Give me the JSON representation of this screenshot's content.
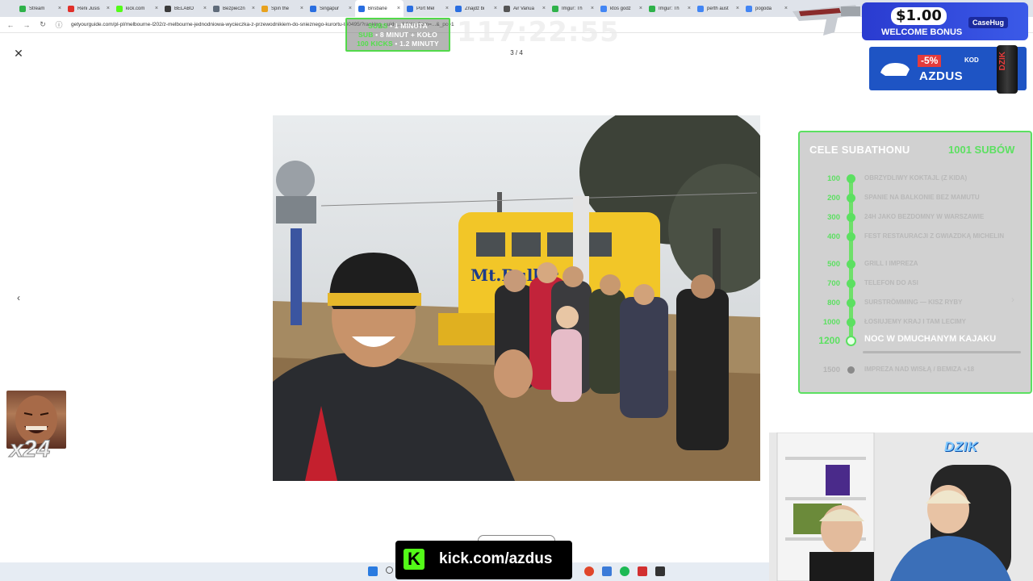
{
  "browser": {
    "tabs": [
      {
        "title": "Stream",
        "color": "#2fb24a"
      },
      {
        "title": "Reni Jusis",
        "color": "#e0302a"
      },
      {
        "title": "kick.com",
        "color": "#53fc18"
      },
      {
        "title": "BELABO",
        "color": "#3b3b3b"
      },
      {
        "title": "Bezpieczn",
        "color": "#5f6b7a"
      },
      {
        "title": "Spin the",
        "color": "#e8a21e"
      },
      {
        "title": "Singapur",
        "color": "#2a6ee0"
      },
      {
        "title": "Brisbane",
        "color": "#2a6ee0"
      },
      {
        "title": "Port Mel",
        "color": "#2a6ee0"
      },
      {
        "title": "Znajdź bi",
        "color": "#2a6ee0"
      },
      {
        "title": "Air Vanua",
        "color": "#555555"
      },
      {
        "title": "Imgur: Th",
        "color": "#2fb24a"
      },
      {
        "title": "ktoś godz",
        "color": "#4285f4"
      },
      {
        "title": "Imgur: Th",
        "color": "#2fb24a"
      },
      {
        "title": "perth aust",
        "color": "#4285f4"
      },
      {
        "title": "pogoda",
        "color": "#4285f4"
      }
    ],
    "url": "getyourguide.com/pl-pl/melbourne-l202/z-melbourne-jednodniowa-wycieczka-z-przewodnikiem-do-snieznego-kurortu-t40495/?ranking_uuid=...&date_from=...&_pc=1"
  },
  "lightbox": {
    "close_icon": "✕",
    "counter": "3 / 4",
    "prev_icon": "‹",
    "next_icon": "›"
  },
  "overlay": {
    "timer_rules": [
      {
        "key": "SUBS",
        "value": "• 1 MINUTA"
      },
      {
        "key": "SUB",
        "value": "• 8 MINUT + KOŁO"
      },
      {
        "key": "100 KICKS",
        "value": "• 1.2 MINUTY"
      }
    ],
    "big_timer": "117:22:55",
    "ad_top": {
      "amount": "$1.00",
      "subtitle": "WELCOME BONUS",
      "brand": "CaseHug"
    },
    "ad_bottom": {
      "discount": "-5%",
      "kod": "KOD",
      "code": "AZDUS",
      "can_label": "DZIK"
    },
    "goals": {
      "title": "CELE SUBATHONU",
      "count": "1001 SUBÓW",
      "progress": 0.0,
      "items": [
        {
          "num": "100",
          "label": "OBRZYDLIWY KOKTAJL (Z KIDA)",
          "state": "done"
        },
        {
          "num": "200",
          "label": "SPANIE NA BALKONIE BEZ MAMUTU",
          "state": "done"
        },
        {
          "num": "300",
          "label": "24H JAKO BEZDOMNY W WARSZAWIE",
          "state": "done"
        },
        {
          "num": "400",
          "label": "FEST RESTAURACJI Z GWIAZDKĄ MICHELIN",
          "state": "done"
        },
        {
          "num": "500",
          "label": "GRILL I IMPREZA",
          "state": "done"
        },
        {
          "num": "700",
          "label": "TELEFON DO ASI",
          "state": "done"
        },
        {
          "num": "800",
          "label": "SURSTRÖMMING — KISZ RYBY",
          "state": "done"
        },
        {
          "num": "1000",
          "label": "ŁOSIUJEMY KRAJ I TAM LECIMY",
          "state": "done"
        },
        {
          "num": "1200",
          "label": "NOC W DMUCHANYM KAJAKU",
          "state": "current"
        },
        {
          "num": "1500",
          "label": "IMPREZA NAD WISŁĄ / BEMIZA +18",
          "state": "future"
        }
      ]
    },
    "emote_count": "x24",
    "kick_logo": "K",
    "kick_url": "kick.com/azdus",
    "webcam_brand": "DZIK"
  }
}
